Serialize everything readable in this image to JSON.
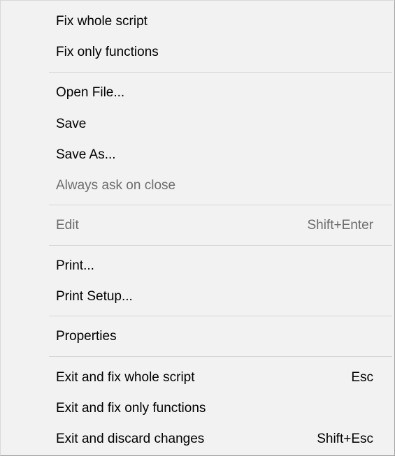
{
  "menu": {
    "fix_whole_script": "Fix whole script",
    "fix_only_functions": "Fix only functions",
    "open_file": "Open File...",
    "save": "Save",
    "save_as": "Save As...",
    "always_ask_on_close": "Always ask on close",
    "edit": {
      "label": "Edit",
      "shortcut": "Shift+Enter"
    },
    "print": "Print...",
    "print_setup": "Print Setup...",
    "properties": "Properties",
    "exit_fix_whole": {
      "label": "Exit and fix whole script",
      "shortcut": "Esc"
    },
    "exit_fix_functions": "Exit and fix only functions",
    "exit_discard": {
      "label": "Exit and discard changes",
      "shortcut": "Shift+Esc"
    }
  },
  "state": {
    "disabled_items": [
      "Always ask on close",
      "Edit"
    ]
  }
}
